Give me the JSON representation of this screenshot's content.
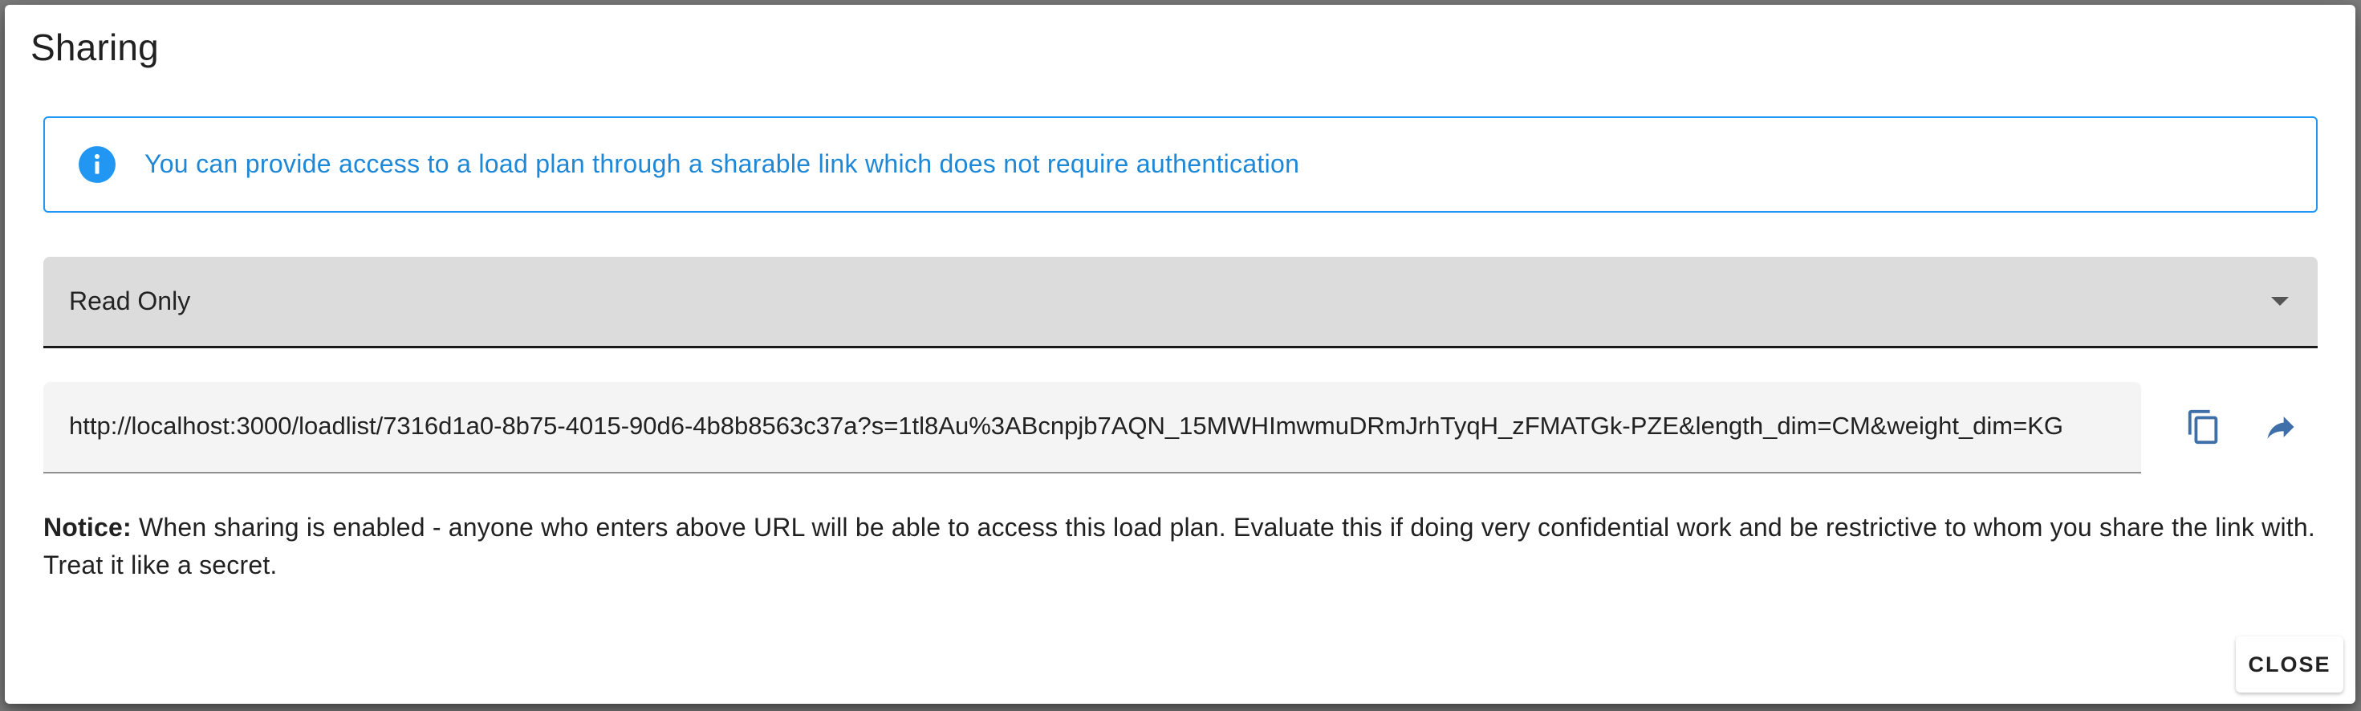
{
  "dialog": {
    "title": "Sharing"
  },
  "info": {
    "icon": "info-icon",
    "text": "You can provide access to a load plan through a sharable link which does not require authentication",
    "color": "#2196f3"
  },
  "access_select": {
    "selected": "Read Only",
    "icon": "chevron-down-icon"
  },
  "share_url": {
    "value": "http://localhost:3000/loadlist/7316d1a0-8b75-4015-90d6-4b8b8563c37a?s=1tl8Au%3ABcnpjb7AQN_15MWHImwmuDRmJrhTyqH_zFMATGk-PZE&length_dim=CM&weight_dim=KG"
  },
  "actions": {
    "copy_icon": "copy-icon",
    "share_icon": "share-icon",
    "icon_color": "#3f6fa8"
  },
  "notice": {
    "label": "Notice:",
    "text": " When sharing is enabled - anyone who enters above URL will be able to access this load plan. Evaluate this if doing very confidential work and be restrictive to whom you share the link with. Treat it like a secret."
  },
  "footer": {
    "close_label": "CLOSE"
  }
}
